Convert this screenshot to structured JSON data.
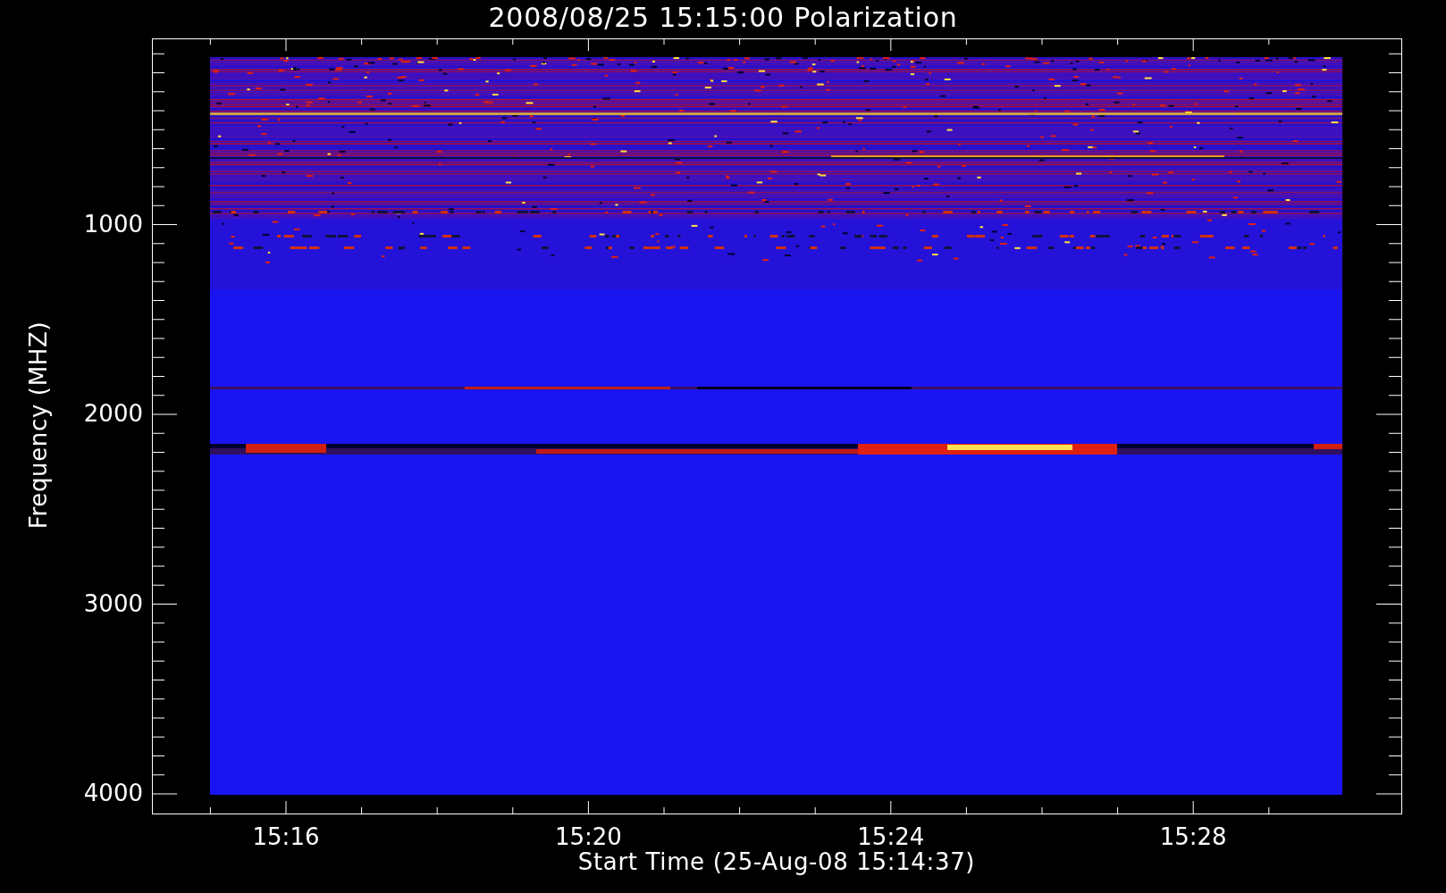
{
  "title": "2008/08/25 15:15:00 Polarization",
  "plot": {
    "xlabel": "Start Time (25-Aug-08 15:14:37)",
    "ylabel": "Frequency (MHZ)",
    "xticks": [
      "15:16",
      "15:20",
      "15:24",
      "15:28"
    ],
    "yticks": [
      "1000",
      "2000",
      "3000",
      "4000"
    ]
  }
}
